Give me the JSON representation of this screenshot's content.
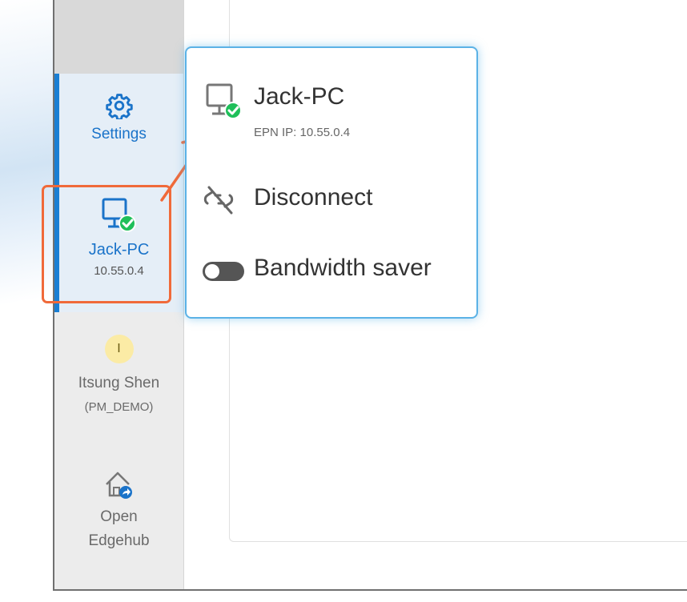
{
  "sidebar": {
    "settings": {
      "label": "Settings",
      "icon": "gear-icon"
    },
    "device": {
      "name": "Jack-PC",
      "ip": "10.55.0.4",
      "icon": "monitor-check-icon"
    },
    "user": {
      "initial": "I",
      "name": "Itsung Shen",
      "org": "(PM_DEMO)"
    },
    "edgehub": {
      "label_line1": "Open",
      "label_line2": "Edgehub",
      "icon": "home-share-icon"
    }
  },
  "popup": {
    "device_name": "Jack-PC",
    "device_ip": "EPN IP: 10.55.0.4",
    "disconnect_label": "Disconnect",
    "bandwidth_label": "Bandwidth saver",
    "bandwidth_enabled": false
  },
  "colors": {
    "accent": "#1a7fd4",
    "annotation": "#f06a3a",
    "connected": "#1fbf5a",
    "popup_border": "#5bb2e6"
  }
}
